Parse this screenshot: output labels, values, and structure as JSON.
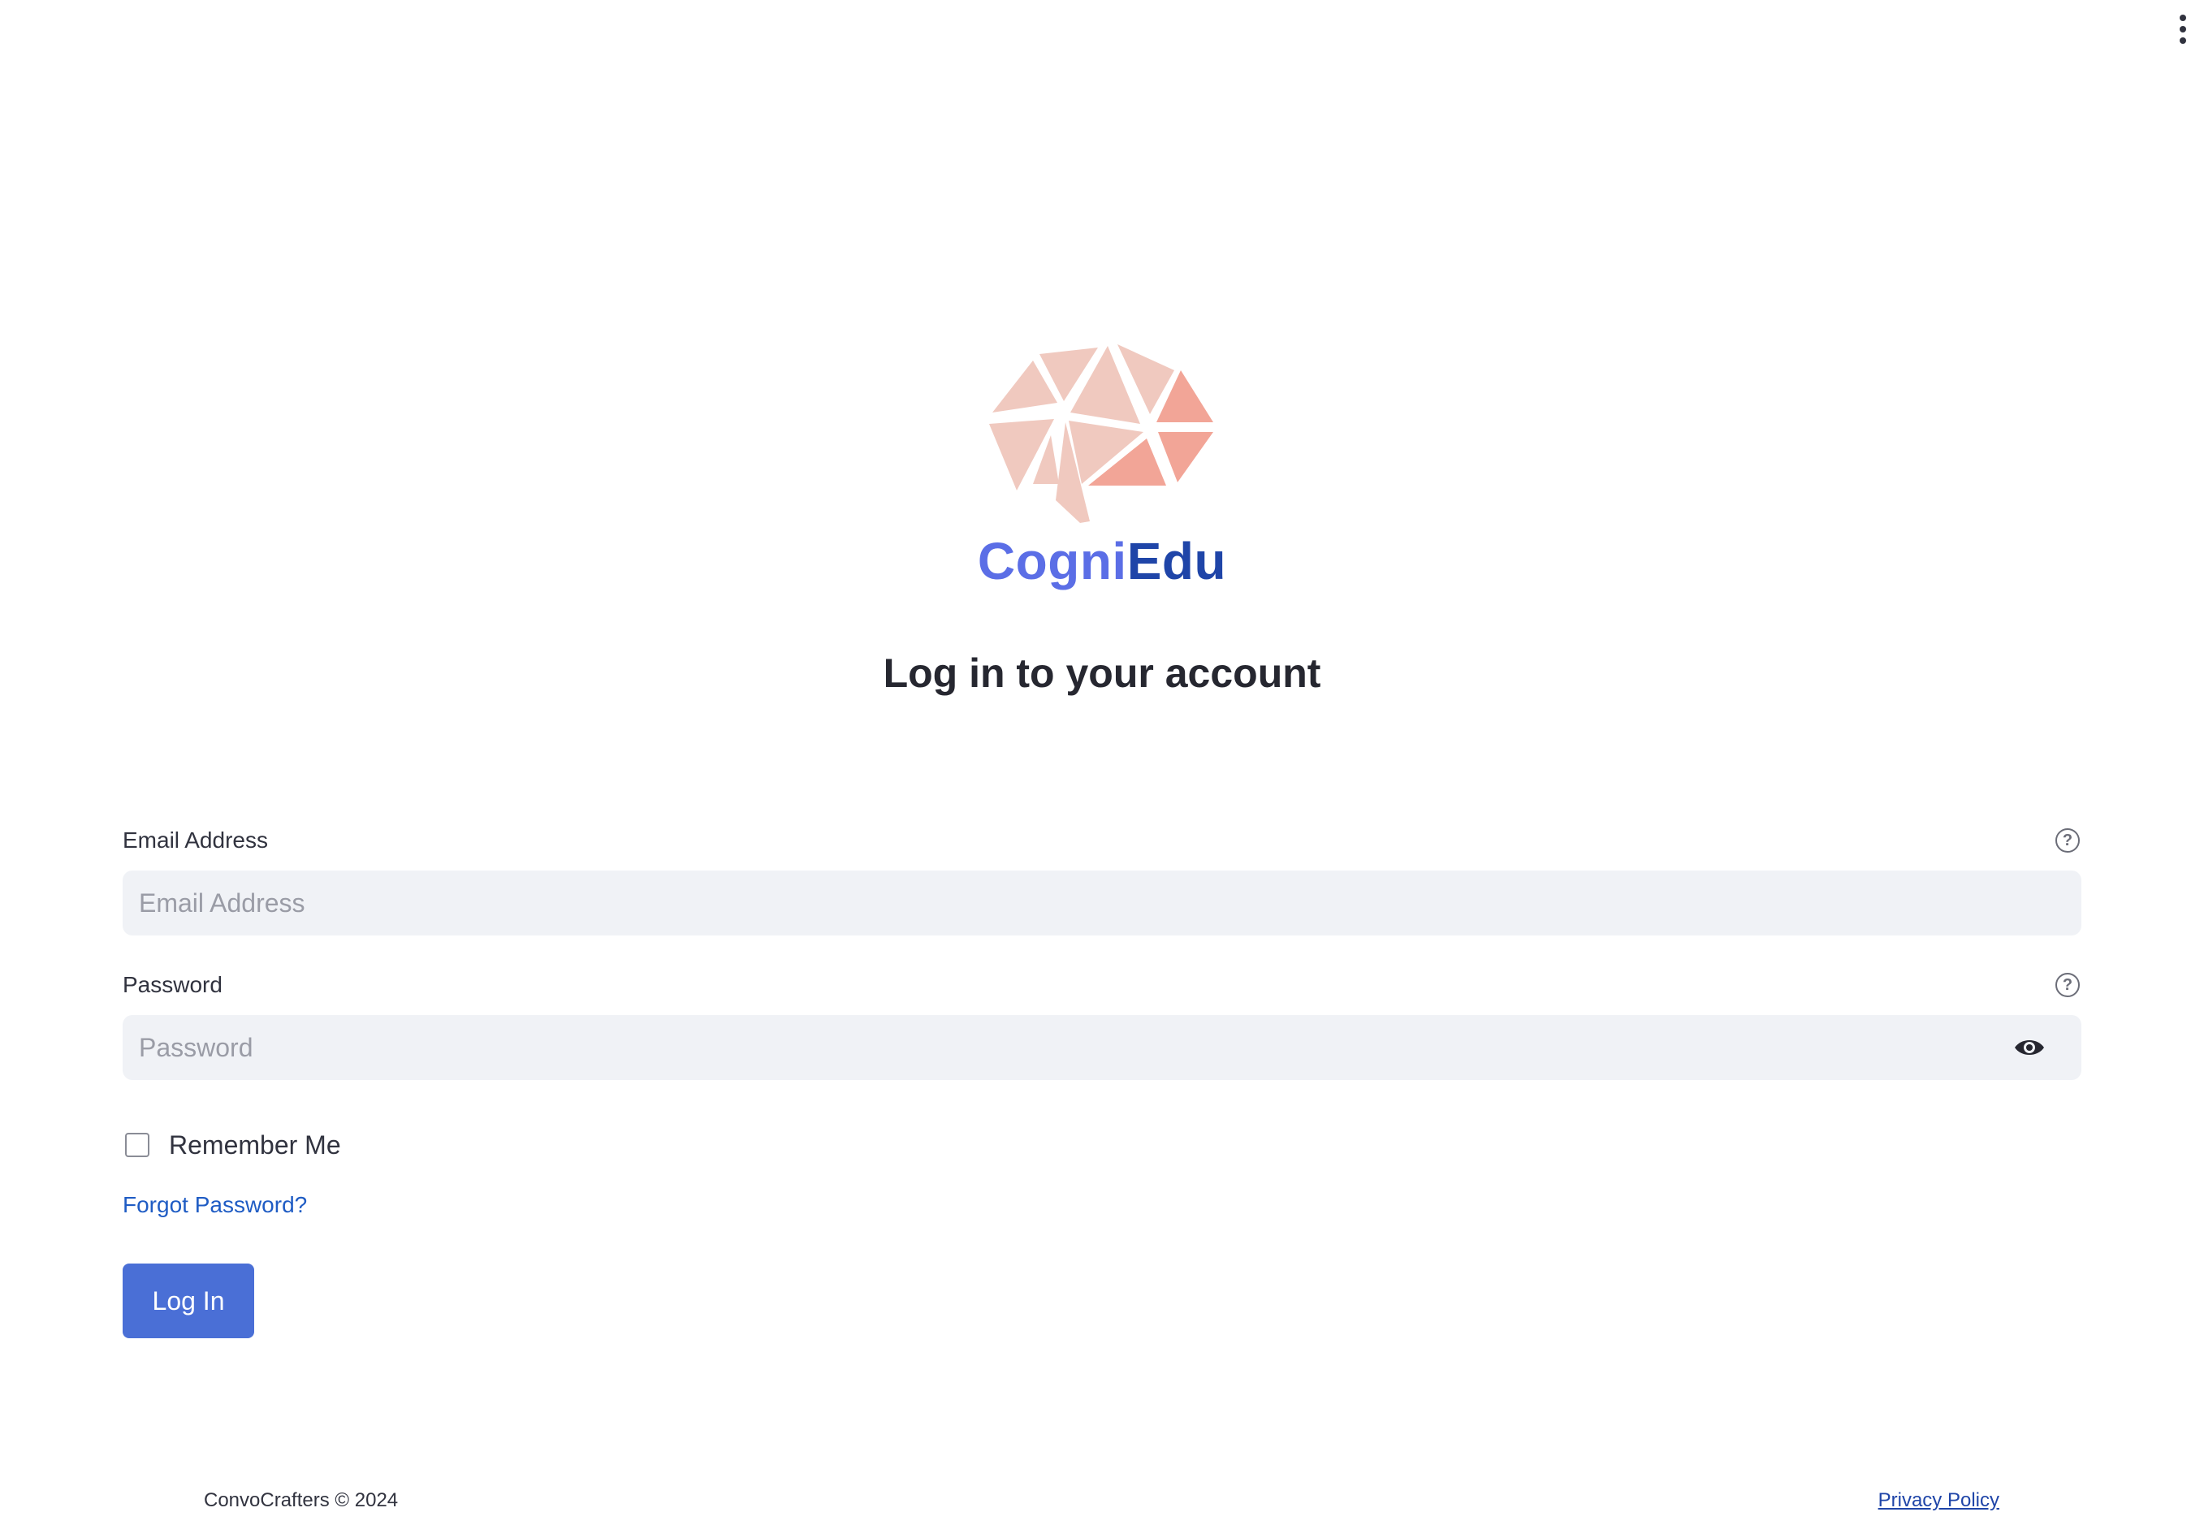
{
  "brand": {
    "name_part1": "Cogni",
    "name_part2": "Edu",
    "logo_colors": [
      "#f0c9bf",
      "#f2a597"
    ]
  },
  "heading": "Log in to your account",
  "form": {
    "email": {
      "label": "Email Address",
      "placeholder": "Email Address",
      "value": ""
    },
    "password": {
      "label": "Password",
      "placeholder": "Password",
      "value": ""
    },
    "remember_label": "Remember Me",
    "remember_checked": false,
    "forgot_label": "Forgot Password?",
    "submit_label": "Log In"
  },
  "footer": {
    "copyright": "ConvoCrafters © 2024",
    "privacy": "Privacy Policy"
  },
  "colors": {
    "accent": "#4a6fd6",
    "link": "#1f5cc4",
    "input_bg": "#f0f2f6"
  },
  "icons": {
    "menu": "kebab-menu-icon",
    "help": "question-circle-icon",
    "show_password": "eye-icon"
  }
}
